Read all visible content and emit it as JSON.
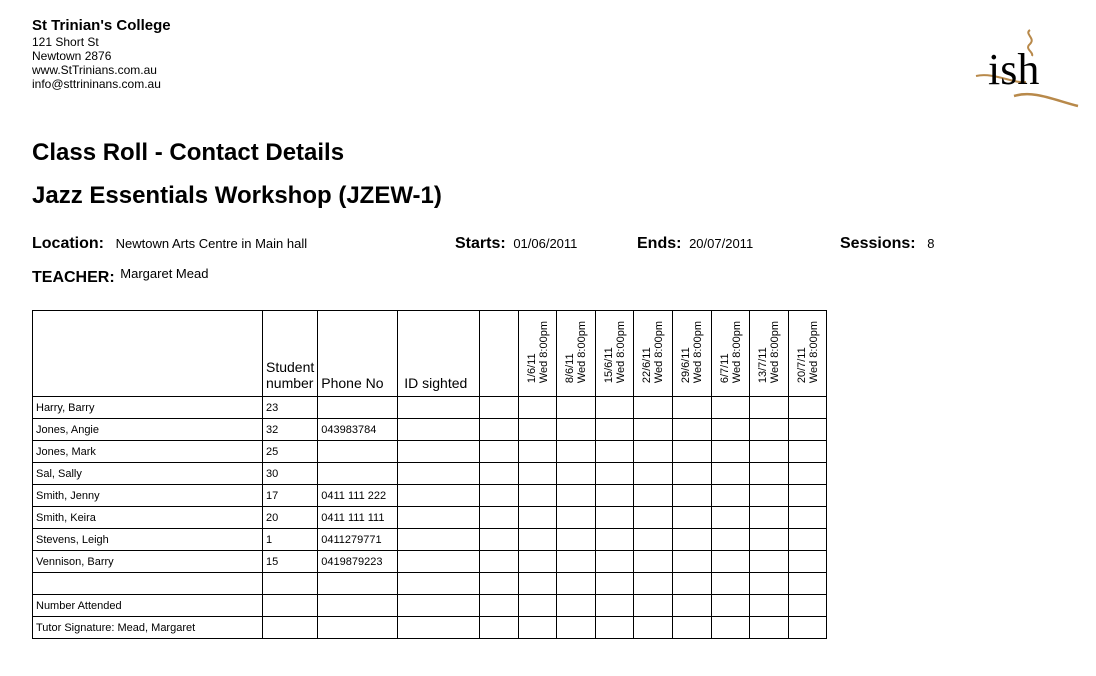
{
  "school": {
    "name": "St Trinian's College",
    "address1": "121 Short St",
    "address2": "Newtown 2876",
    "website": "www.StTrinians.com.au",
    "email": "info@sttrininans.com.au",
    "logo_text": "ish"
  },
  "report_title": "Class Roll - Contact Details",
  "course_title": "Jazz Essentials Workshop (JZEW-1)",
  "location": {
    "label": "Location:",
    "value": "Newtown Arts Centre in Main hall"
  },
  "starts": {
    "label": "Starts:",
    "value": "01/06/2011"
  },
  "ends": {
    "label": "Ends:",
    "value": "20/07/2011"
  },
  "sessions": {
    "label": "Sessions:",
    "value": "8"
  },
  "teacher": {
    "label": "TEACHER:",
    "value": "Margaret Mead"
  },
  "table": {
    "headers": {
      "student_number": "Student\nnumber",
      "phone": "Phone No",
      "id_sighted": "ID sighted"
    },
    "dates": [
      "1/6/11\nWed 8:00pm",
      "8/6/11\nWed 8:00pm",
      "15/6/11\nWed 8:00pm",
      "22/6/11\nWed 8:00pm",
      "29/6/11\nWed 8:00pm",
      "6/7/11\nWed 8:00pm",
      "13/7/11\nWed 8:00pm",
      "20/7/11\nWed 8:00pm"
    ],
    "rows": [
      {
        "name": "Harry, Barry",
        "number": "23",
        "phone": ""
      },
      {
        "name": "Jones, Angie",
        "number": "32",
        "phone": "043983784"
      },
      {
        "name": "Jones, Mark",
        "number": "25",
        "phone": ""
      },
      {
        "name": "Sal, Sally",
        "number": "30",
        "phone": ""
      },
      {
        "name": "Smith, Jenny",
        "number": "17",
        "phone": "0411 111 222"
      },
      {
        "name": "Smith, Keira",
        "number": "20",
        "phone": "0411 111 111"
      },
      {
        "name": "Stevens, Leigh",
        "number": "1",
        "phone": "0411279771"
      },
      {
        "name": "Vennison, Barry",
        "number": "15",
        "phone": "0419879223"
      },
      {
        "name": "",
        "number": "",
        "phone": ""
      },
      {
        "name": "Number Attended",
        "number": "",
        "phone": ""
      },
      {
        "name": "Tutor Signature: Mead, Margaret",
        "number": "",
        "phone": ""
      }
    ]
  }
}
